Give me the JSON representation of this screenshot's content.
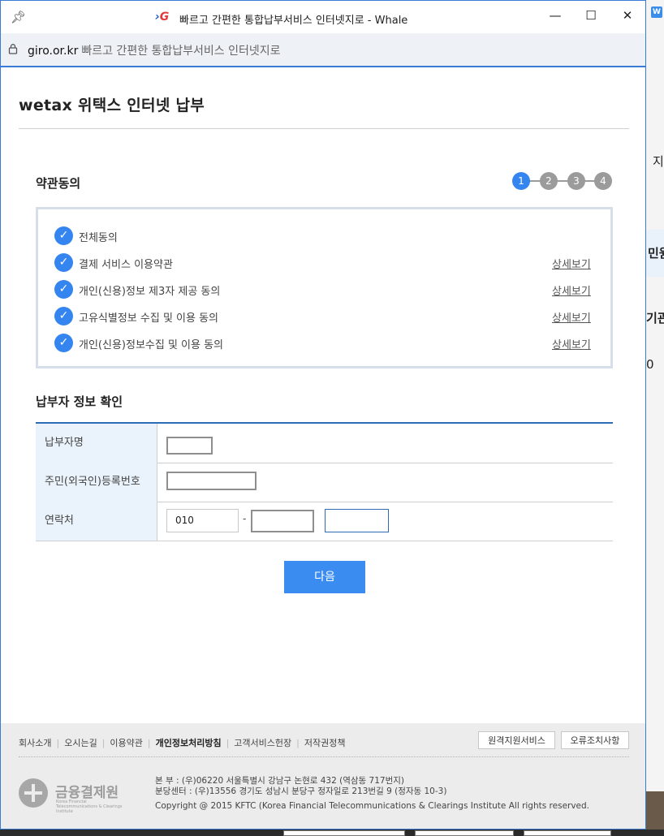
{
  "browser": {
    "window_title": "빠르고 간편한 통합납부서비스 인터넷지로 - Whale",
    "logo": "G",
    "url_host": "giro.or.kr",
    "url_page_title": "빠르고 간편한 통합납부서비스 인터넷지로",
    "controls": {
      "minimize": "—",
      "maximize": "☐",
      "close": "✕"
    }
  },
  "background_page": {
    "logo": "W",
    "fragments": [
      "지",
      "민원",
      "기관",
      "0"
    ]
  },
  "page": {
    "title": "wetax 위택스 인터넷 납부"
  },
  "terms": {
    "section_title": "약관동의",
    "steps": [
      "1",
      "2",
      "3",
      "4"
    ],
    "active_step": 1,
    "items": [
      {
        "label": "전체동의",
        "checked": true,
        "detail": ""
      },
      {
        "label": "결제 서비스 이용약관",
        "checked": true,
        "detail": "상세보기"
      },
      {
        "label": "개인(신용)정보 제3자 제공 동의",
        "checked": true,
        "detail": "상세보기"
      },
      {
        "label": "고유식별정보 수집 및 이용 동의",
        "checked": true,
        "detail": "상세보기"
      },
      {
        "label": "개인(신용)정보수집 및 이용 동의",
        "checked": true,
        "detail": "상세보기"
      }
    ]
  },
  "payer": {
    "section_title": "납부자 정보 확인",
    "name_label": "납부자명",
    "name_value": "",
    "id_label": "주민(외국인)등록번호",
    "id_value": "",
    "phone_label": "연락처",
    "phone_prefix": "010",
    "phone_separator": "-",
    "phone_middle": "",
    "phone_last": ""
  },
  "actions": {
    "next_label": "다음"
  },
  "footer": {
    "links": [
      "회사소개",
      "오시는길",
      "이용약관",
      "개인정보처리방침",
      "고객서비스헌장",
      "저작권정책"
    ],
    "buttons": [
      "원격지원서비스",
      "오류조치사항"
    ],
    "org_name": "금융결제원",
    "org_name_en": "Korea Financial Telecommunications & Clearings Institute",
    "address_hq": "본 부 : (우)06220 서울특별시 강남구 논현로 432 (역삼동 717번지)",
    "address_branch": "분당센터 : (우)13556 경기도 성남시 분당구 정자일로 213번길 9 (정자동 10-3)",
    "copyright": "Copyright @ 2015 KFTC (Korea Financial Telecommunications & Clearings Institute All rights reserved."
  },
  "colors": {
    "accent": "#3485f0",
    "step_inactive": "#9b9b9b",
    "table_header_bg": "#eaf2fb",
    "table_top_border": "#2d6cb5"
  }
}
